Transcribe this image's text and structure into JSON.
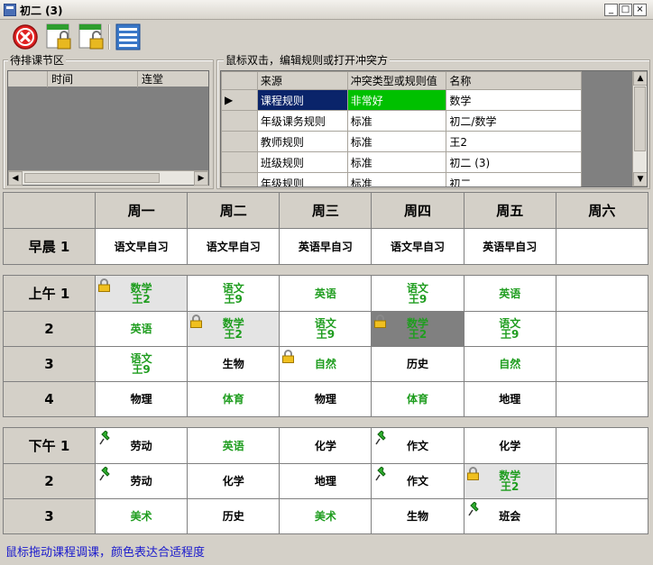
{
  "window": {
    "title": "初二 (3)"
  },
  "pending": {
    "title": "待排课节区",
    "columns": [
      "",
      "时间",
      "连堂"
    ]
  },
  "rules": {
    "title": "鼠标双击，编辑规则或打开冲突方",
    "columns": [
      "来源",
      "冲突类型或规则值",
      "名称"
    ],
    "rows": [
      {
        "source": "课程规则",
        "type": "非常好",
        "name": "数学"
      },
      {
        "source": "年级课务规则",
        "type": "标准",
        "name": "初二/数学"
      },
      {
        "source": "教师规则",
        "type": "标准",
        "name": "王2"
      },
      {
        "source": "班级规则",
        "type": "标准",
        "name": "初二 (3)"
      },
      {
        "source": "年级规则",
        "type": "标准",
        "name": "初二"
      }
    ]
  },
  "schedule": {
    "days": [
      "周一",
      "周二",
      "周三",
      "周四",
      "周五",
      "周六"
    ],
    "rows": [
      {
        "label": "早晨  1",
        "cells": [
          {
            "t": "语文早自习"
          },
          {
            "t": "语文早自习"
          },
          {
            "t": "英语早自习"
          },
          {
            "t": "语文早自习"
          },
          {
            "t": "英语早自习"
          },
          {
            "t": ""
          }
        ]
      },
      {
        "label": "上午  1",
        "cells": [
          {
            "t": "数学",
            "t2": "王2",
            "g": true,
            "lock": true,
            "bg": "#e4e4e4"
          },
          {
            "t": "语文",
            "t2": "王9",
            "g": true
          },
          {
            "t": "英语",
            "g": true
          },
          {
            "t": "语文",
            "t2": "王9",
            "g": true
          },
          {
            "t": "英语",
            "g": true
          },
          {
            "t": ""
          }
        ]
      },
      {
        "label": "2",
        "cells": [
          {
            "t": "英语",
            "g": true
          },
          {
            "t": "数学",
            "t2": "王2",
            "g": true,
            "lock": true,
            "bg": "#e4e4e4"
          },
          {
            "t": "语文",
            "t2": "王9",
            "g": true
          },
          {
            "t": "数学",
            "t2": "王2",
            "g": true,
            "lock": true,
            "bg": "#808080"
          },
          {
            "t": "语文",
            "t2": "王9",
            "g": true
          },
          {
            "t": ""
          }
        ]
      },
      {
        "label": "3",
        "cells": [
          {
            "t": "语文",
            "t2": "王9",
            "g": true
          },
          {
            "t": "生物"
          },
          {
            "t": "自然",
            "g": true,
            "lock": true
          },
          {
            "t": "历史"
          },
          {
            "t": "自然",
            "g": true
          },
          {
            "t": ""
          }
        ]
      },
      {
        "label": "4",
        "cells": [
          {
            "t": "物理"
          },
          {
            "t": "体育",
            "g": true
          },
          {
            "t": "物理"
          },
          {
            "t": "体育",
            "g": true
          },
          {
            "t": "地理"
          },
          {
            "t": ""
          }
        ]
      },
      {
        "label": "下午  1",
        "cells": [
          {
            "t": "劳动",
            "pin": true
          },
          {
            "t": "英语",
            "g": true
          },
          {
            "t": "化学"
          },
          {
            "t": "作文",
            "pin": true
          },
          {
            "t": "化学"
          },
          {
            "t": ""
          }
        ]
      },
      {
        "label": "2",
        "cells": [
          {
            "t": "劳动",
            "pin": true
          },
          {
            "t": "化学"
          },
          {
            "t": "地理"
          },
          {
            "t": "作文",
            "pin": true
          },
          {
            "t": "数学",
            "t2": "王2",
            "g": true,
            "lock": true,
            "bg": "#e4e4e4"
          },
          {
            "t": ""
          }
        ]
      },
      {
        "label": "3",
        "cells": [
          {
            "t": "美术",
            "g": true
          },
          {
            "t": "历史"
          },
          {
            "t": "美术",
            "g": true
          },
          {
            "t": "生物"
          },
          {
            "t": "班会",
            "pin": true
          },
          {
            "t": ""
          }
        ]
      }
    ]
  },
  "status": "鼠标拖动课程调课，颜色表达合适程度",
  "colors": {
    "good": "#1f9d1f",
    "selected": "#0a246a",
    "excellent": "#00c000"
  }
}
